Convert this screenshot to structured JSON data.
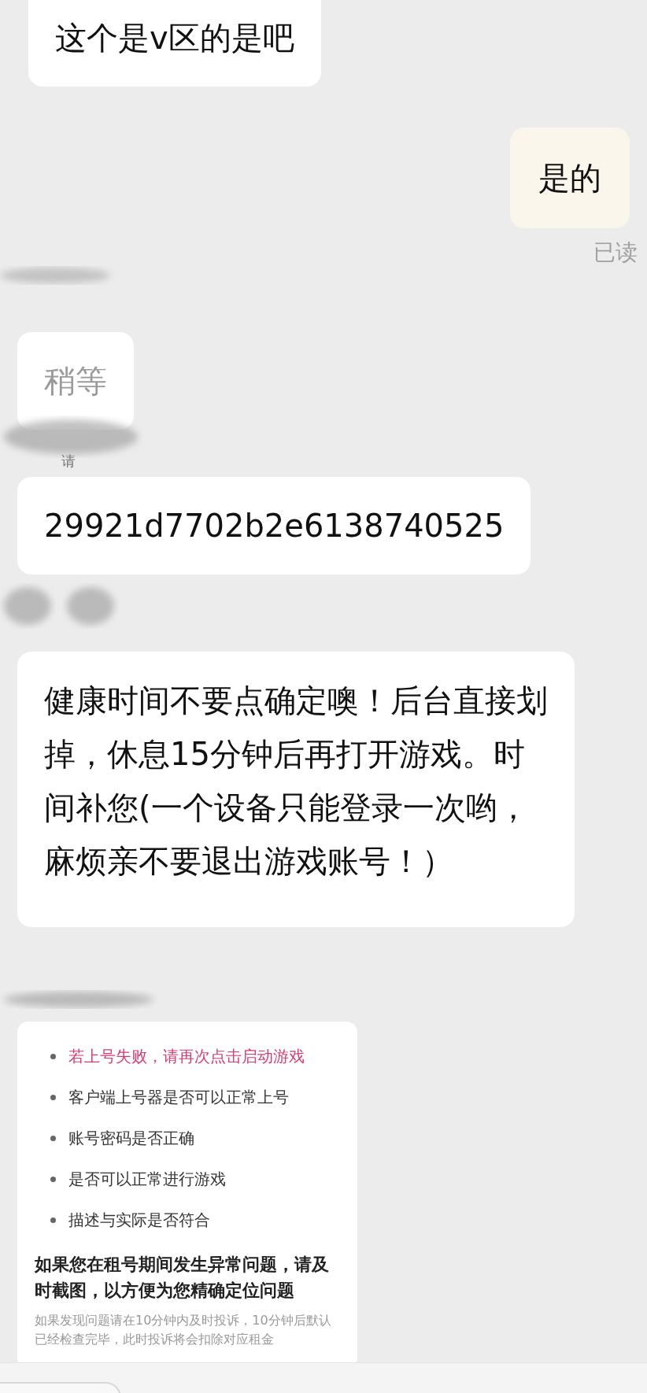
{
  "messages": [
    {
      "kind": "text",
      "outgoing": false,
      "text": "这个是v区的是吧"
    },
    {
      "kind": "text",
      "outgoing": true,
      "text": "是的",
      "status": "已读"
    },
    {
      "kind": "text",
      "outgoing": false,
      "text": "稍等",
      "faded": true
    },
    {
      "kind": "fragment",
      "outgoing": false,
      "text": "请"
    },
    {
      "kind": "text",
      "outgoing": false,
      "text": "29921d7702b2e6138740525"
    },
    {
      "kind": "text",
      "outgoing": false,
      "text": "健康时间不要点确定噢！后台直接划掉，休息15分钟后再打开游戏。时间补您(一个设备只能登录一次哟，麻烦亲不要退出游戏账号！）"
    },
    {
      "kind": "card",
      "outgoing": false,
      "items": [
        {
          "text": "若上号失败，请再次点击启动游戏",
          "emphasis": true
        },
        {
          "text": "客户端上号器是否可以正常上号",
          "emphasis": false
        },
        {
          "text": "账号密码是否正确",
          "emphasis": false
        },
        {
          "text": "是否可以正常进行游戏",
          "emphasis": false
        },
        {
          "text": "描述与实际是否符合",
          "emphasis": false
        }
      ],
      "notice": "如果您在租号期间发生异常问题，请及时截图，以方便为您精确定位问题",
      "footnote": "如果发现问题请在10分钟内及时投诉，10分钟后默认已经检查完毕，此时投诉将会扣除对应租金"
    }
  ]
}
